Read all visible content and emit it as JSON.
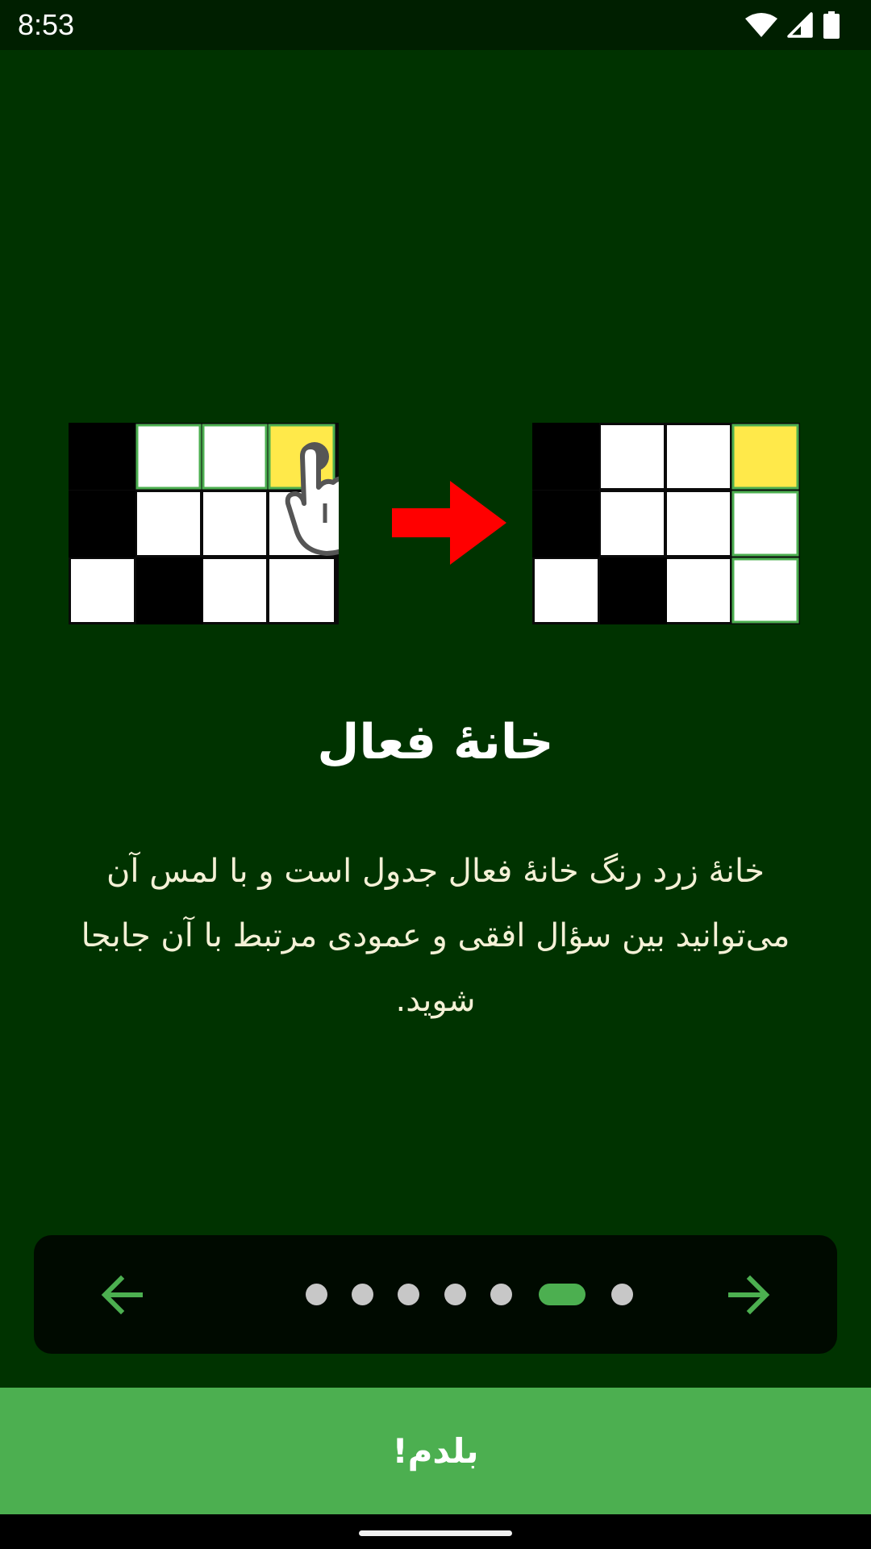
{
  "status_bar": {
    "time": "8:53",
    "icons": [
      "wifi-icon",
      "signal-icon",
      "battery-icon"
    ]
  },
  "illustration": {
    "arrow_color": "#ff0000",
    "active_cell_color": "#ffe94a",
    "icons": [
      "tap-hand-icon",
      "right-arrow-icon"
    ]
  },
  "onboarding": {
    "title": "خانهٔ فعال",
    "description": "خانهٔ زرد رنگ خانهٔ فعال جدول است و با لمس آن می‌توانید بین سؤال افقی و عمودی مرتبط با آن جابجا شوید."
  },
  "pager": {
    "page_count": 7,
    "active_page": 6,
    "colors": {
      "active": "#4caf50",
      "inactive": "#c7c7c7"
    },
    "icons": [
      "arrow-left-icon",
      "arrow-right-icon"
    ]
  },
  "actions": {
    "got_it_label": "بلدم!"
  }
}
